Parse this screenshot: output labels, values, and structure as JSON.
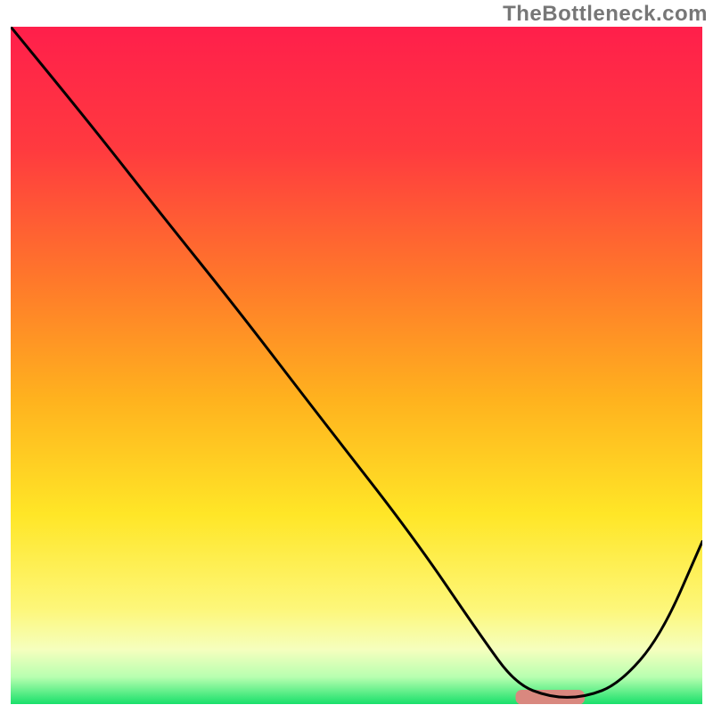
{
  "watermark": "TheBottleneck.com",
  "chart_data": {
    "type": "line",
    "title": "",
    "xlabel": "",
    "ylabel": "",
    "xlim": [
      0,
      100
    ],
    "ylim": [
      0,
      100
    ],
    "grid": false,
    "legend": false,
    "series": [
      {
        "name": "curve",
        "color": "#000000",
        "x": [
          0,
          12,
          22,
          33,
          45,
          58,
          68,
          73,
          78,
          83,
          88,
          94,
          100
        ],
        "y": [
          100,
          85,
          72,
          58,
          42,
          25,
          10,
          3,
          1,
          1,
          3,
          10,
          24
        ]
      }
    ],
    "marker": {
      "name": "optimal-zone",
      "color": "#d9887f",
      "x_start": 73,
      "x_end": 83,
      "y": 1,
      "thickness_pct": 2.2
    },
    "background_gradient": {
      "stops": [
        {
          "pct": 0,
          "color": "#ff1f4b"
        },
        {
          "pct": 18,
          "color": "#ff3a3f"
        },
        {
          "pct": 38,
          "color": "#ff7a2a"
        },
        {
          "pct": 55,
          "color": "#ffb21e"
        },
        {
          "pct": 72,
          "color": "#ffe627"
        },
        {
          "pct": 86,
          "color": "#fdf77a"
        },
        {
          "pct": 92,
          "color": "#f5ffbe"
        },
        {
          "pct": 96,
          "color": "#b8ffb0"
        },
        {
          "pct": 100,
          "color": "#19e06a"
        }
      ]
    }
  }
}
